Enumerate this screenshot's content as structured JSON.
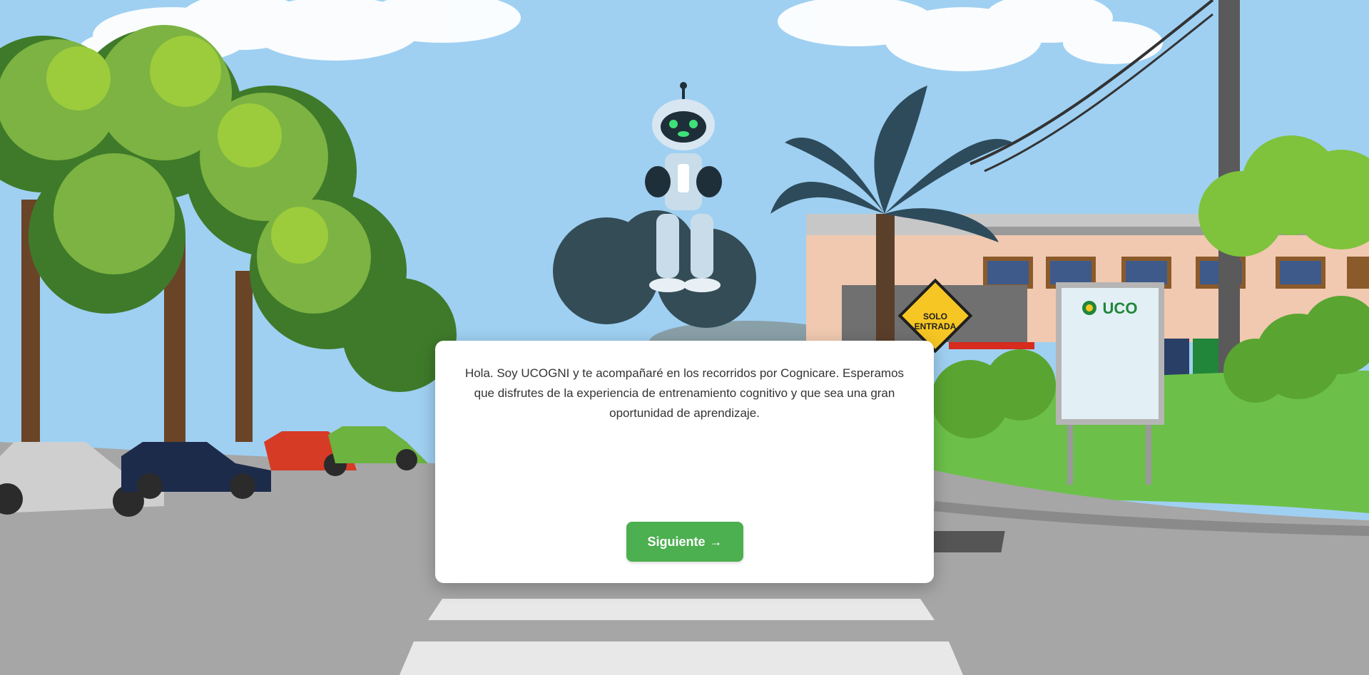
{
  "scene": {
    "sign": {
      "line1": "SOLO",
      "line2": "ENTRADA"
    },
    "billboard_logo": "UCO"
  },
  "dialog": {
    "message": "Hola. Soy UCOGNI y te acompañaré en los recorridos por Cognicare. Esperamos que disfrutes de la experiencia de entrenamiento cognitivo y que sea una gran oportunidad de aprendizaje.",
    "next_label": "Siguiente",
    "next_arrow": "→"
  },
  "colors": {
    "sky": "#9fd0f2",
    "button_green": "#4caf50",
    "dialog_bg": "#ffffff",
    "text": "#333333",
    "sign_yellow": "#f6c624",
    "grass": "#6cc04a",
    "road": "#a6a6a6"
  }
}
